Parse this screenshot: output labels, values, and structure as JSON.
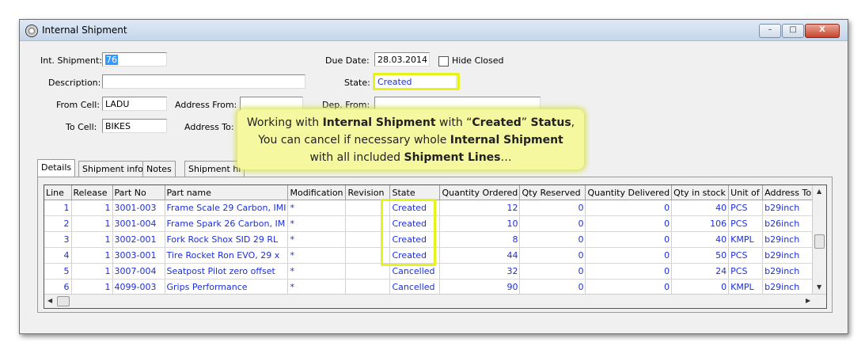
{
  "window": {
    "title": "Internal Shipment",
    "minimize": "–",
    "maximize": "□",
    "close": "X",
    "icon": "gear-icon"
  },
  "form": {
    "int_shipment_label": "Int. Shipment:",
    "int_shipment_value": "76",
    "description_label": "Description:",
    "description_value": "",
    "from_cell_label": "From Cell:",
    "from_cell_value": "LADU",
    "to_cell_label": "To Cell:",
    "to_cell_value": "BIKES",
    "address_from_label": "Address From:",
    "address_to_label": "Address To:",
    "due_date_label": "Due Date:",
    "due_date_value": "28.03.2014",
    "hide_closed_label": "Hide Closed",
    "state_label": "State:",
    "state_value": "Created",
    "dep_from_label": "Dep. From:"
  },
  "tabs": [
    "Details",
    "Shipment info",
    "Notes",
    "Shipment hi"
  ],
  "table": {
    "headers": [
      "Line",
      "Release",
      "Part No",
      "Part name",
      "Modification",
      "Revision",
      "State",
      "Quantity Ordered",
      "Qty Reserved",
      "Quantity Delivered",
      "Qty in stock",
      "Unit of",
      "Address To"
    ],
    "rows": [
      [
        "1",
        "1",
        "3001-003",
        "Frame Scale 29 Carbon, IMI",
        "*",
        "",
        "Created",
        "12",
        "0",
        "0",
        "40",
        "PCS",
        "b29inch"
      ],
      [
        "2",
        "1",
        "3001-004",
        "Frame Spark 26 Carbon, IM",
        "*",
        "",
        "Created",
        "10",
        "0",
        "0",
        "106",
        "PCS",
        "b26inch"
      ],
      [
        "3",
        "1",
        "3002-001",
        "Fork Rock Shox SID 29 RL",
        "*",
        "",
        "Created",
        "8",
        "0",
        "0",
        "40",
        "KMPL",
        "b29inch"
      ],
      [
        "4",
        "1",
        "3003-001",
        "Tire Rocket Ron EVO, 29 x",
        "*",
        "",
        "Created",
        "44",
        "0",
        "0",
        "50",
        "PCS",
        "b29inch"
      ],
      [
        "5",
        "1",
        "3007-004",
        "Seatpost Pilot zero offset",
        "*",
        "",
        "Cancelled",
        "32",
        "0",
        "0",
        "24",
        "PCS",
        "b29inch"
      ],
      [
        "6",
        "1",
        "4099-003",
        "Grips Performance",
        "*",
        "",
        "Cancelled",
        "90",
        "0",
        "0",
        "0",
        "KMPL",
        "b29inch"
      ]
    ]
  },
  "callout": {
    "line1_pre": "Working with ",
    "line1_bold1": "Internal Shipment",
    "line1_mid": " with “",
    "line1_bold2": "Created",
    "line1_mid2": "” ",
    "line1_bold3": "Status",
    "line1_end": ",",
    "line2_pre": "You can cancel if necessary whole ",
    "line2_bold": "Internal Shipment",
    "line3_pre": "with all included ",
    "line3_bold": "Shipment Lines",
    "line3_end": "…"
  },
  "colors": {
    "value_blue": "#1d2fd9",
    "highlight": "#e6f21a",
    "callout_bg": "#f6f8a0",
    "selection": "#3399ff"
  }
}
